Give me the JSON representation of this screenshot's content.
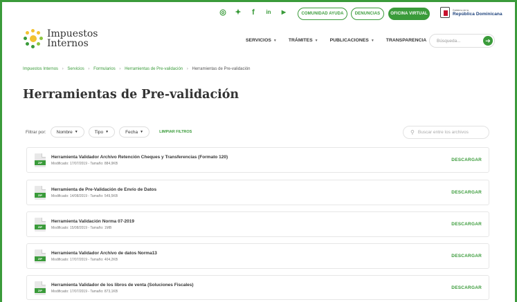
{
  "topbar": {
    "social": [
      {
        "name": "instagram-icon",
        "glyph": "◎"
      },
      {
        "name": "twitter-icon",
        "glyph": "✦"
      },
      {
        "name": "facebook-icon",
        "glyph": "f"
      },
      {
        "name": "linkedin-icon",
        "glyph": "in"
      },
      {
        "name": "youtube-icon",
        "glyph": "▶"
      }
    ],
    "comunidad_label": "COMUNIDAD AYUDA",
    "denuncias_label": "DENUNCIAS",
    "oficina_label": "OFICINA VIRTUAL",
    "gov_small": "Gobierno de la",
    "gov_big": "República Dominicana"
  },
  "header": {
    "logo_line1": "Impuestos",
    "logo_line2": "Internos",
    "nav": [
      {
        "label": "SERVICIOS",
        "caret": "▼"
      },
      {
        "label": "TRÁMITES",
        "caret": "▼"
      },
      {
        "label": "PUBLICACIONES",
        "caret": "▼"
      },
      {
        "label": "TRANSPARENCIA",
        "caret": ""
      }
    ],
    "search_placeholder": "Búsqueda...",
    "search_button": "➔"
  },
  "breadcrumb": {
    "items": [
      "Impuestos Internos",
      "Servicios",
      "Formularios",
      "Herramientas de Pre-validación"
    ],
    "current": "Herramientas de Pre-validación",
    "separator": "›"
  },
  "page_title": "Herramientas de Pre-validación",
  "filters": {
    "label": "Filtrar por:",
    "nombre": "Nombre",
    "tipo": "Tipo",
    "fecha": "Fecha",
    "caret": "▼",
    "clear": "LIMPIAR FILTROS",
    "search_placeholder": "Buscar entre los archivos"
  },
  "files": [
    {
      "name": "Herramienta Validador Archivo Retención Cheques y Transferencias (Formato 120)",
      "meta": "Modificado: 17/07/2019 - Tamaño: 884,9KB",
      "type": "ZIP",
      "action": "DESCARGAR"
    },
    {
      "name": "Herramienta de Pre-Validación de Envío de Datos",
      "meta": "Modificado: 14/08/2019 - Tamaño: 549,5KB",
      "type": "ZIP",
      "action": "DESCARGAR"
    },
    {
      "name": "Herramienta Validación Norma 07-2019",
      "meta": "Modificado: 15/08/2019 - Tamaño: 1MB",
      "type": "ZIP",
      "action": "DESCARGAR"
    },
    {
      "name": "Herramienta Validador Archivo de datos Norma13",
      "meta": "Modificado: 17/07/2019 - Tamaño: 404,2KB",
      "type": "ZIP",
      "action": "DESCARGAR"
    },
    {
      "name": "Herramienta Validador de los libros de venta (Soluciones Fiscales)",
      "meta": "Modificado: 17/07/2019 - Tamaño: 873,1KB",
      "type": "ZIP",
      "action": "DESCARGAR"
    }
  ],
  "colors": {
    "accent": "#3a9b3a"
  }
}
